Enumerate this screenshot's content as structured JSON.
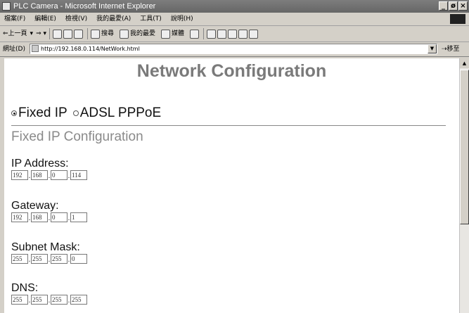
{
  "window": {
    "title": "PLC Camera - Microsoft Internet Explorer",
    "buttons": [
      "_",
      "ø",
      "×"
    ]
  },
  "menu": {
    "items": [
      "檔案(F)",
      "編輯(E)",
      "檢視(V)",
      "我的最愛(A)",
      "工具(T)",
      "說明(H)"
    ]
  },
  "toolbar": {
    "back": "⇐上一頁",
    "search": "搜尋",
    "favorites": "我的最愛",
    "media": "媒體"
  },
  "address": {
    "label": "網址(D)",
    "url": "http://192.168.0.114/NetWork.html",
    "go": "移至"
  },
  "page": {
    "title": "Network Configuration",
    "modes": [
      {
        "label": "Fixed IP",
        "checked": true
      },
      {
        "label": "ADSL PPPoE",
        "checked": false
      }
    ],
    "section_title": "Fixed IP Configuration",
    "fields": [
      {
        "label": "IP Address:",
        "values": [
          "192",
          "168",
          "0",
          "114"
        ]
      },
      {
        "label": "Gateway:",
        "values": [
          "192",
          "168",
          "0",
          "1"
        ]
      },
      {
        "label": "Subnet Mask:",
        "values": [
          "255",
          "255",
          "255",
          "0"
        ]
      },
      {
        "label": "DNS:",
        "values": [
          "255",
          "255",
          "255",
          "255"
        ]
      }
    ]
  }
}
